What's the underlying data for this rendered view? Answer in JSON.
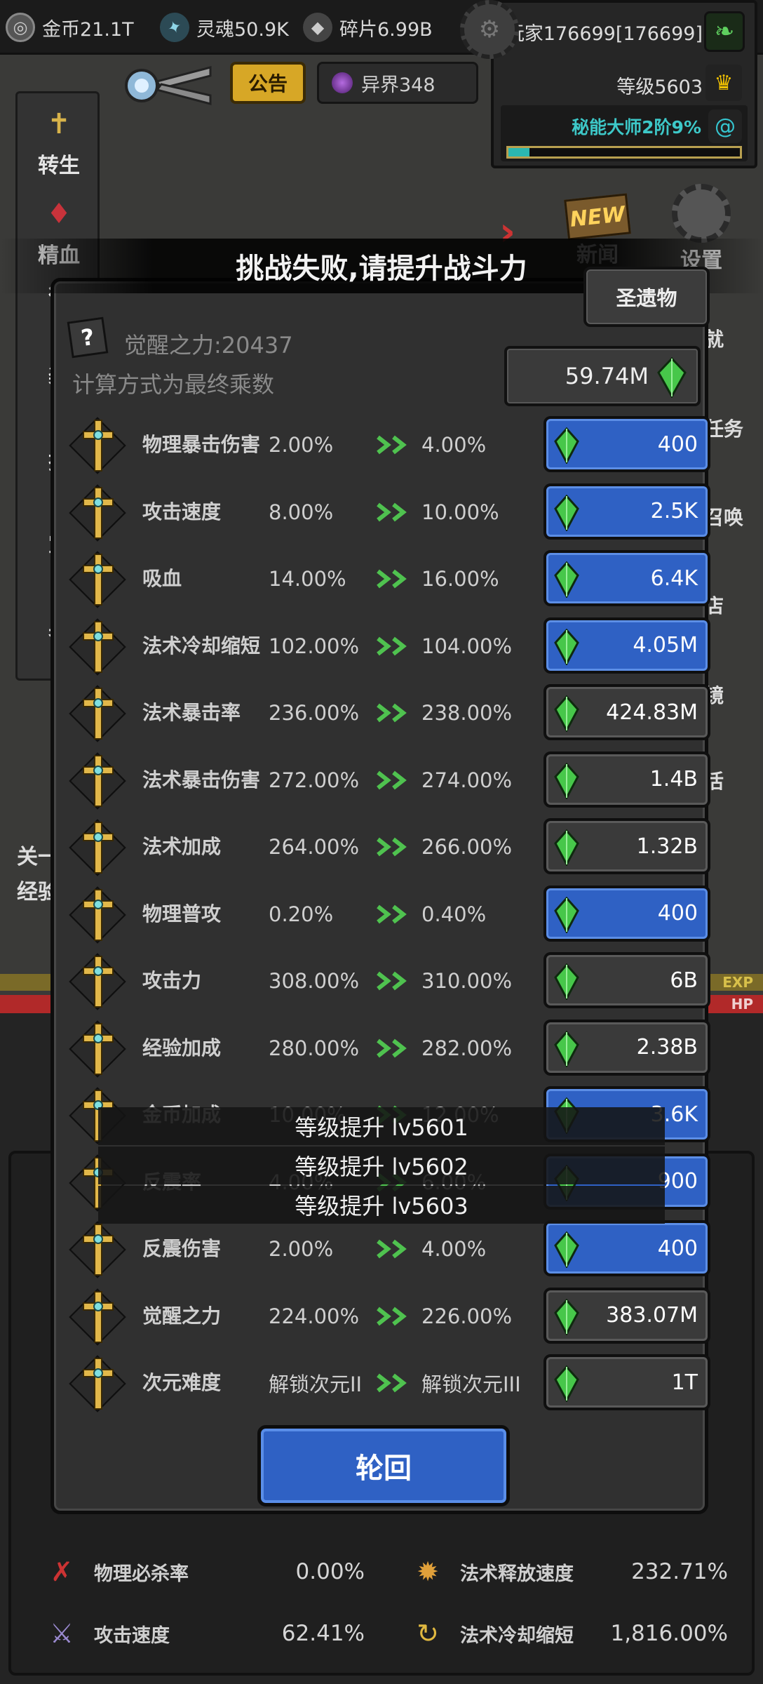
{
  "resources": {
    "gold": "金币21.1T",
    "soul": "灵魂50.9K",
    "shard": "碎片6.99B"
  },
  "player": {
    "name": "玩家176699[176699]",
    "level": "等级5603",
    "rank": "秘能大师2阶9%",
    "rank_progress_percent": 9
  },
  "top_buttons": {
    "notice": "公告",
    "otherworld": "异界348"
  },
  "left_menu": [
    {
      "label": "转生",
      "icon": "cross-icon"
    },
    {
      "label": "精血",
      "icon": "blood-drop-icon"
    },
    {
      "label": "徘",
      "icon": "sword-icon"
    },
    {
      "label": "装",
      "icon": "armor-icon"
    },
    {
      "label": "技",
      "icon": "skill-icon"
    },
    {
      "label": "宝",
      "icon": "treasure-icon"
    },
    {
      "label": "奥",
      "icon": "arcane-icon"
    }
  ],
  "right_menu": {
    "news": "新闻",
    "news_badge": "NEW",
    "settings": "设置"
  },
  "right_peek": [
    "就",
    "任务",
    "召唤",
    "店",
    "镜",
    "活"
  ],
  "left_peek": [
    "关一",
    "经验"
  ],
  "bars": {
    "exp": "EXP",
    "hp": "HP"
  },
  "dialog": {
    "title": "挑战失败,请提升战斗力",
    "relic_button": "圣遗物",
    "help": "?",
    "awaken_power": "觉醒之力:20437",
    "calc_note": "计算方式为最终乘数",
    "total_cost": "59.74M",
    "reborn_button": "轮回",
    "rows": [
      {
        "name": "物理暴击伤害",
        "cur": "2.00%",
        "next": "4.00%",
        "cost": "400",
        "style": "blue"
      },
      {
        "name": "攻击速度",
        "cur": "8.00%",
        "next": "10.00%",
        "cost": "2.5K",
        "style": "blue"
      },
      {
        "name": "吸血",
        "cur": "14.00%",
        "next": "16.00%",
        "cost": "6.4K",
        "style": "blue"
      },
      {
        "name": "法术冷却缩短",
        "cur": "102.00%",
        "next": "104.00%",
        "cost": "4.05M",
        "style": "blue"
      },
      {
        "name": "法术暴击率",
        "cur": "236.00%",
        "next": "238.00%",
        "cost": "424.83M",
        "style": "gray"
      },
      {
        "name": "法术暴击伤害",
        "cur": "272.00%",
        "next": "274.00%",
        "cost": "1.4B",
        "style": "gray"
      },
      {
        "name": "法术加成",
        "cur": "264.00%",
        "next": "266.00%",
        "cost": "1.32B",
        "style": "gray"
      },
      {
        "name": "物理普攻",
        "cur": "0.20%",
        "next": "0.40%",
        "cost": "400",
        "style": "blue"
      },
      {
        "name": "攻击力",
        "cur": "308.00%",
        "next": "310.00%",
        "cost": "6B",
        "style": "gray"
      },
      {
        "name": "经验加成",
        "cur": "280.00%",
        "next": "282.00%",
        "cost": "2.38B",
        "style": "gray"
      },
      {
        "name": "金币加成",
        "cur": "10.00%",
        "next": "12.00%",
        "cost": "3.6K",
        "style": "blue"
      },
      {
        "name": "反震率",
        "cur": "4.00%",
        "next": "6.00%",
        "cost": "900",
        "style": "blue"
      },
      {
        "name": "反震伤害",
        "cur": "2.00%",
        "next": "4.00%",
        "cost": "400",
        "style": "blue"
      },
      {
        "name": "觉醒之力",
        "cur": "224.00%",
        "next": "226.00%",
        "cost": "383.07M",
        "style": "gray"
      },
      {
        "name": "次元难度",
        "cur": "解锁次元II",
        "next": "解锁次元III",
        "cost": "1T",
        "style": "gray"
      }
    ]
  },
  "toasts": [
    "等级提升 lv5601",
    "等级提升 lv5602",
    "等级提升 lv5603"
  ],
  "bottom_stats": [
    {
      "name": "物理必杀率",
      "value": "0.00%",
      "icon": "crit-claw-icon"
    },
    {
      "name": "法术释放速度",
      "value": "232.71%",
      "icon": "flame-shield-icon"
    },
    {
      "name": "攻击速度",
      "value": "62.41%",
      "icon": "crossed-swords-icon"
    },
    {
      "name": "法术冷却缩短",
      "value": "1,816.00%",
      "icon": "spiral-icon"
    }
  ],
  "colors": {
    "blue_button": "#2f61c4",
    "gold": "#d7a726",
    "hp": "#b12929",
    "rank_text": "#3dc8c8",
    "gem": "#47c74a"
  }
}
